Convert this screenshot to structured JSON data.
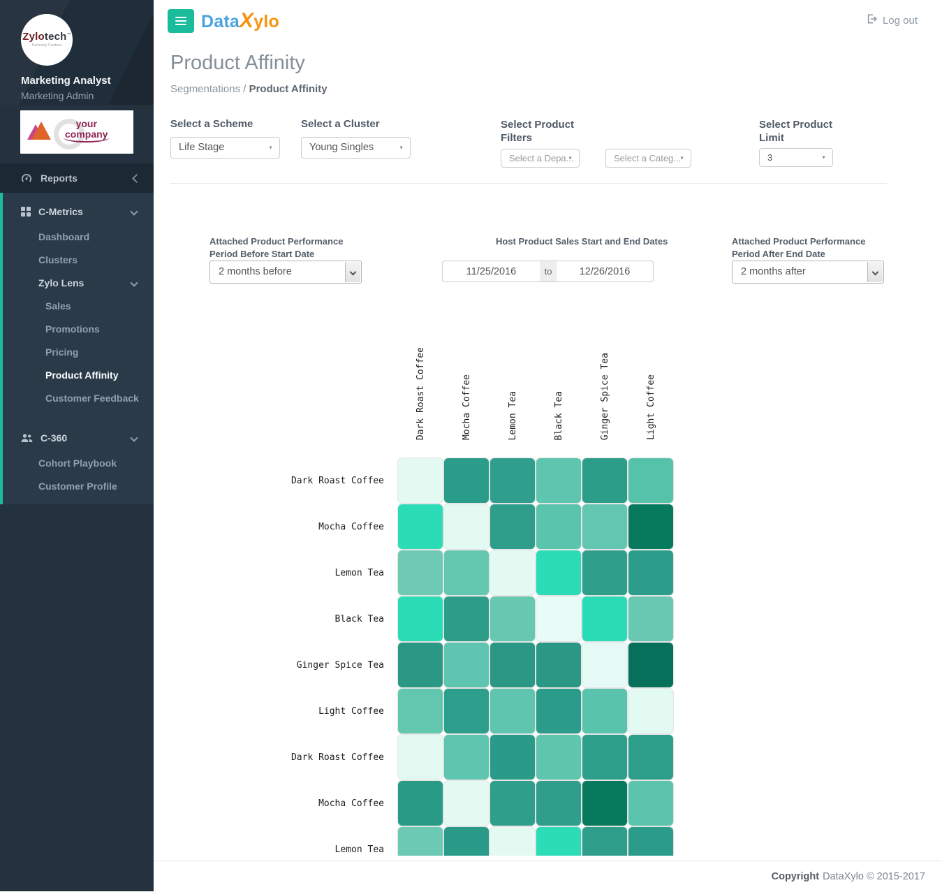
{
  "header": {
    "brand_part1": "Data",
    "brand_x": "X",
    "brand_rest": "ylo",
    "logout_label": "Log out"
  },
  "sidebar": {
    "logo": {
      "part1": "Zylo",
      "part2": "tech",
      "tm": "™",
      "tagline": "Formerly Custora"
    },
    "user_name": "Marketing Analyst",
    "user_role": "Marketing Admin",
    "company_logo": {
      "line1": "your",
      "line2": "company"
    },
    "reports_label": "Reports",
    "menu": [
      {
        "label": "C-Metrics",
        "level": 1,
        "icon": "grid-icon",
        "chevron": true,
        "bright": true
      },
      {
        "label": "Dashboard",
        "level": 2
      },
      {
        "label": "Clusters",
        "level": 2
      },
      {
        "label": "Zylo Lens",
        "level": 2,
        "chevron": true,
        "bright": true
      },
      {
        "label": "Sales",
        "level": 3
      },
      {
        "label": "Promotions",
        "level": 3
      },
      {
        "label": "Pricing",
        "level": 3
      },
      {
        "label": "Product Affinity",
        "level": 3,
        "active": true
      },
      {
        "label": "Customer Feedback",
        "level": 3
      },
      {
        "label": "C-360",
        "level": 1,
        "icon": "users-icon",
        "chevron": true,
        "bright": true,
        "gap": true
      },
      {
        "label": "Cohort Playbook",
        "level": 2
      },
      {
        "label": "Customer Profile",
        "level": 2
      }
    ]
  },
  "page": {
    "title": "Product Affinity",
    "breadcrumb_root": "Segmentations",
    "breadcrumb_sep": "/",
    "breadcrumb_current": "Product Affinity"
  },
  "filters": {
    "scheme": {
      "label": "Select a Scheme",
      "value": "Life Stage"
    },
    "cluster": {
      "label": "Select a Cluster",
      "value": "Young Singles"
    },
    "product_filters": {
      "label": "Select Product Filters",
      "department_placeholder": "Select a Depa...",
      "category_placeholder": "Select a Categ..."
    },
    "product_limit": {
      "label": "Select Product Limit",
      "value": "3"
    }
  },
  "date_controls": {
    "before": {
      "label": "Attached Product Performance Period Before Start Date",
      "value": "2 months before"
    },
    "range": {
      "label": "Host Product Sales Start and End Dates",
      "start": "11/25/2016",
      "to_label": "to",
      "end": "12/26/2016"
    },
    "after": {
      "label": "Attached Product Performance Period After End Date",
      "value": "2 months after"
    }
  },
  "chart_data": {
    "type": "heatmap",
    "title": "Product Affinity matrix (color intensity encodes affinity; no numeric labels shown)",
    "columns": [
      "Dark Roast Coffee",
      "Mocha Coffee",
      "Lemon Tea",
      "Black Tea",
      "Ginger Spice Tea",
      "Light Coffee"
    ],
    "rows": [
      "Dark Roast Coffee",
      "Mocha Coffee",
      "Lemon Tea",
      "Black Tea",
      "Ginger Spice Tea",
      "Light Coffee",
      "Dark Roast Coffee",
      "Mocha Coffee",
      "Lemon Tea"
    ],
    "cell_colors": [
      [
        "#e3faf3",
        "#2a9d8a",
        "#2f9e8c",
        "#5ec5ae",
        "#2b9d89",
        "#55c2a9"
      ],
      [
        "#2bdcb6",
        "#e3faf3",
        "#2e9d8a",
        "#5bc4ac",
        "#62c6b0",
        "#077a5e"
      ],
      [
        "#6ecab3",
        "#64c7b0",
        "#e3faf3",
        "#2cdcb7",
        "#2f9f8c",
        "#2b9d8a"
      ],
      [
        "#2adcb6",
        "#2d9d8a",
        "#66c8b0",
        "#e8fbf6",
        "#2adcb6",
        "#68c8b1"
      ],
      [
        "#2a9884",
        "#5fc5b0",
        "#2a9884",
        "#2a9884",
        "#e6faf5",
        "#07705b"
      ],
      [
        "#63c7af",
        "#2d9e8b",
        "#5fc5ae",
        "#2b9c89",
        "#5ac3ab",
        "#e3faf3"
      ],
      [
        "#e3faf3",
        "#5ec5ae",
        "#2a9b88",
        "#5fc6ae",
        "#2d9e8a",
        "#2d9e8a"
      ],
      [
        "#289a86",
        "#e3faf3",
        "#2f9f8b",
        "#2f9f8b",
        "#077a5d",
        "#5cc4ad"
      ],
      [
        "#6cc9b3",
        "#2a9b88",
        "#e3faf3",
        "#2bdcb6",
        "#2e9e8b",
        "#2a9c89"
      ]
    ],
    "legend": "none",
    "grid": "off"
  },
  "footer": {
    "bold": "Copyright",
    "text": "DataXylo © 2015-2017"
  }
}
